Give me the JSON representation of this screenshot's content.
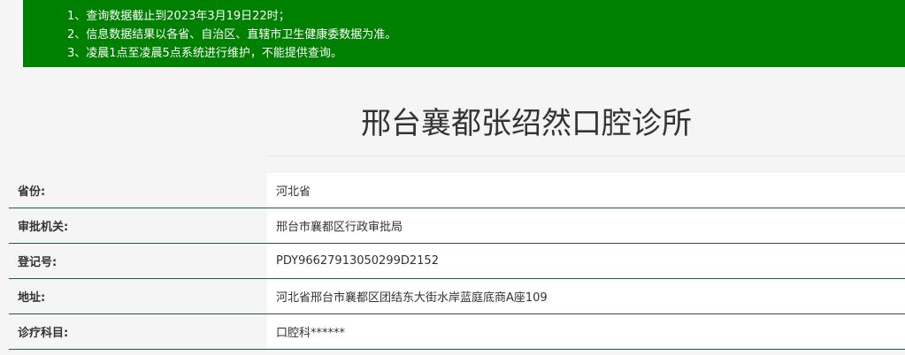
{
  "notice": {
    "lines": [
      "1、查询数据截止到2023年3月19日22时；",
      "2、信息数据结果以各省、自治区、直辖市卫生健康委数据为准。",
      "3、凌晨1点至凌晨5点系统进行维护，不能提供查询。"
    ],
    "background_color": "#008000"
  },
  "title": "邢台襄都张绍然口腔诊所",
  "details": [
    {
      "label": "省份:",
      "value": "河北省"
    },
    {
      "label": "审批机关:",
      "value": "邢台市襄都区行政审批局"
    },
    {
      "label": "登记号:",
      "value": "PDY96627913050299D2152"
    },
    {
      "label": "地址:",
      "value": "河北省邢台市襄都区团结东大街水岸蓝庭底商A座109"
    },
    {
      "label": "诊疗科目:",
      "value": "口腔科******"
    }
  ],
  "colors": {
    "row_border": "#1b5e3a",
    "title_text": "#333333"
  }
}
